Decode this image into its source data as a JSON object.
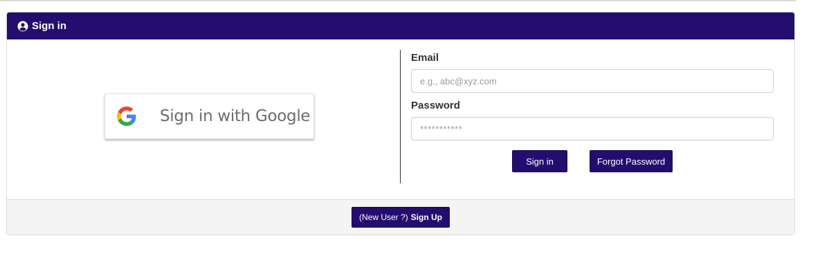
{
  "header": {
    "title": "Sign in",
    "icon": "user-circle-icon"
  },
  "google": {
    "label": "Sign in with Google",
    "icon": "google-g-icon"
  },
  "form": {
    "email_label": "Email",
    "email_placeholder": "e.g., abc@xyz.com",
    "email_value": "",
    "password_label": "Password",
    "password_placeholder": "***********",
    "password_value": "",
    "signin_label": "Sign in",
    "forgot_label": "Forgot Password"
  },
  "footer": {
    "signup_prefix": "(New User ?)",
    "signup_label": "Sign Up"
  },
  "colors": {
    "primary": "#230e6f",
    "footer_bg": "#f4f4f4"
  }
}
